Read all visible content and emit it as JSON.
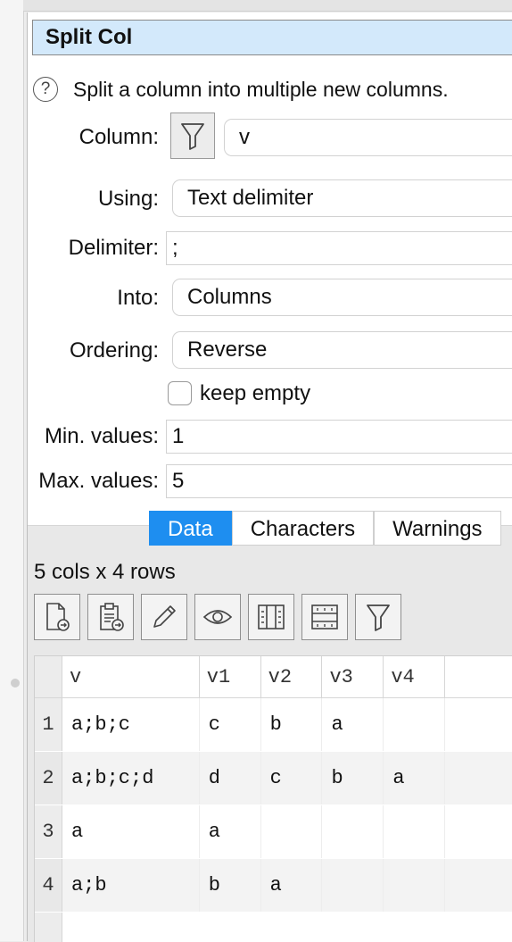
{
  "dialog": {
    "title": "Split Col",
    "help_text": "Split a column into multiple new columns."
  },
  "form": {
    "column_label": "Column:",
    "column_value": "v",
    "using_label": "Using:",
    "using_value": "Text delimiter",
    "delimiter_label": "Delimiter:",
    "delimiter_value": ";",
    "into_label": "Into:",
    "into_value": "Columns",
    "ordering_label": "Ordering:",
    "ordering_value": "Reverse",
    "keep_empty_label": "keep empty",
    "keep_empty_checked": false,
    "min_values_label": "Min. values:",
    "min_values_value": "1",
    "max_values_label": "Max. values:",
    "max_values_value": "5"
  },
  "tabs": [
    {
      "label": "Data",
      "active": true
    },
    {
      "label": "Characters",
      "active": false
    },
    {
      "label": "Warnings",
      "active": false
    }
  ],
  "summary": "5 cols x 4 rows",
  "toolbar": [
    "export-icon",
    "paste-icon",
    "pencil-icon",
    "eye-icon",
    "columns-icon",
    "rows-icon",
    "filter-icon"
  ],
  "table": {
    "headers": [
      "v",
      "v1",
      "v2",
      "v3",
      "v4"
    ],
    "rows": [
      {
        "num": "1",
        "cells": [
          "a;b;c",
          "c",
          "b",
          "a",
          ""
        ]
      },
      {
        "num": "2",
        "cells": [
          "a;b;c;d",
          "d",
          "c",
          "b",
          "a"
        ]
      },
      {
        "num": "3",
        "cells": [
          "a",
          "a",
          "",
          "",
          ""
        ]
      },
      {
        "num": "4",
        "cells": [
          "a;b",
          "b",
          "a",
          "",
          ""
        ]
      }
    ]
  },
  "colors": {
    "accent": "#1e8ef0",
    "title_bg": "#d3e9fb"
  }
}
